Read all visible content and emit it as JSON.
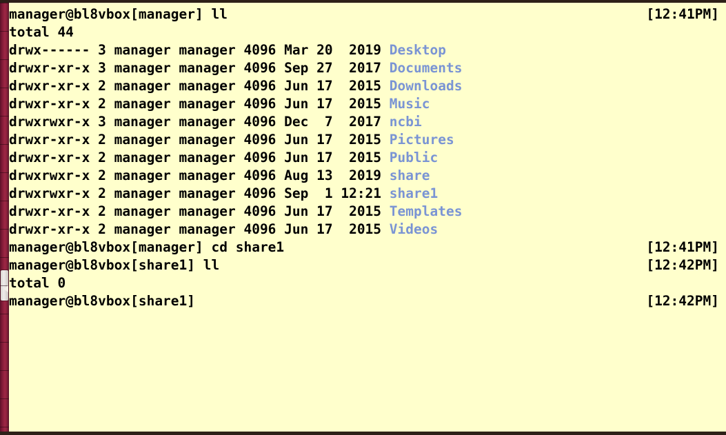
{
  "terminal": {
    "background_color": "#ffffcc",
    "foreground_color": "#000000",
    "directory_color": "#7a94d4",
    "scrollbar_color": "#9e2744",
    "window_border_color": "#2e2018",
    "lines": [
      {
        "kind": "prompt",
        "text": "manager@bl8vbox[manager] ll",
        "timestamp": "[12:41PM]"
      },
      {
        "kind": "output",
        "text": "total 44",
        "timestamp": ""
      },
      {
        "kind": "listing",
        "permissions": "drwx------",
        "links": "3",
        "owner": "manager",
        "group": "manager",
        "size": "4096",
        "month": "Mar",
        "day": "20",
        "year": "2019",
        "name": "Desktop",
        "text": "drwx------ 3 manager manager 4096 Mar 20  2019 ",
        "timestamp": ""
      },
      {
        "kind": "listing",
        "permissions": "drwxr-xr-x",
        "links": "3",
        "owner": "manager",
        "group": "manager",
        "size": "4096",
        "month": "Sep",
        "day": "27",
        "year": "2017",
        "name": "Documents",
        "text": "drwxr-xr-x 3 manager manager 4096 Sep 27  2017 ",
        "timestamp": ""
      },
      {
        "kind": "listing",
        "permissions": "drwxr-xr-x",
        "links": "2",
        "owner": "manager",
        "group": "manager",
        "size": "4096",
        "month": "Jun",
        "day": "17",
        "year": "2015",
        "name": "Downloads",
        "text": "drwxr-xr-x 2 manager manager 4096 Jun 17  2015 ",
        "timestamp": ""
      },
      {
        "kind": "listing",
        "permissions": "drwxr-xr-x",
        "links": "2",
        "owner": "manager",
        "group": "manager",
        "size": "4096",
        "month": "Jun",
        "day": "17",
        "year": "2015",
        "name": "Music",
        "text": "drwxr-xr-x 2 manager manager 4096 Jun 17  2015 ",
        "timestamp": ""
      },
      {
        "kind": "listing",
        "permissions": "drwxrwxr-x",
        "links": "3",
        "owner": "manager",
        "group": "manager",
        "size": "4096",
        "month": "Dec",
        "day": " 7",
        "year": "2017",
        "name": "ncbi",
        "text": "drwxrwxr-x 3 manager manager 4096 Dec  7  2017 ",
        "timestamp": ""
      },
      {
        "kind": "listing",
        "permissions": "drwxr-xr-x",
        "links": "2",
        "owner": "manager",
        "group": "manager",
        "size": "4096",
        "month": "Jun",
        "day": "17",
        "year": "2015",
        "name": "Pictures",
        "text": "drwxr-xr-x 2 manager manager 4096 Jun 17  2015 ",
        "timestamp": ""
      },
      {
        "kind": "listing",
        "permissions": "drwxr-xr-x",
        "links": "2",
        "owner": "manager",
        "group": "manager",
        "size": "4096",
        "month": "Jun",
        "day": "17",
        "year": "2015",
        "name": "Public",
        "text": "drwxr-xr-x 2 manager manager 4096 Jun 17  2015 ",
        "timestamp": ""
      },
      {
        "kind": "listing",
        "permissions": "drwxrwxr-x",
        "links": "2",
        "owner": "manager",
        "group": "manager",
        "size": "4096",
        "month": "Aug",
        "day": "13",
        "year": "2019",
        "name": "share",
        "text": "drwxrwxr-x 2 manager manager 4096 Aug 13  2019 ",
        "timestamp": ""
      },
      {
        "kind": "listing",
        "permissions": "drwxrwxr-x",
        "links": "2",
        "owner": "manager",
        "group": "manager",
        "size": "4096",
        "month": "Sep",
        "day": " 1",
        "year": "12:21",
        "name": "share1",
        "text": "drwxrwxr-x 2 manager manager 4096 Sep  1 12:21 ",
        "timestamp": ""
      },
      {
        "kind": "listing",
        "permissions": "drwxr-xr-x",
        "links": "2",
        "owner": "manager",
        "group": "manager",
        "size": "4096",
        "month": "Jun",
        "day": "17",
        "year": "2015",
        "name": "Templates",
        "text": "drwxr-xr-x 2 manager manager 4096 Jun 17  2015 ",
        "timestamp": ""
      },
      {
        "kind": "listing",
        "permissions": "drwxr-xr-x",
        "links": "2",
        "owner": "manager",
        "group": "manager",
        "size": "4096",
        "month": "Jun",
        "day": "17",
        "year": "2015",
        "name": "Videos",
        "text": "drwxr-xr-x 2 manager manager 4096 Jun 17  2015 ",
        "timestamp": ""
      },
      {
        "kind": "prompt",
        "text": "manager@bl8vbox[manager] cd share1",
        "timestamp": "[12:41PM]"
      },
      {
        "kind": "prompt",
        "text": "manager@bl8vbox[share1] ll",
        "timestamp": "[12:42PM]"
      },
      {
        "kind": "output",
        "text": "total 0",
        "timestamp": ""
      },
      {
        "kind": "prompt",
        "text": "manager@bl8vbox[share1]",
        "timestamp": "[12:42PM]"
      }
    ]
  }
}
